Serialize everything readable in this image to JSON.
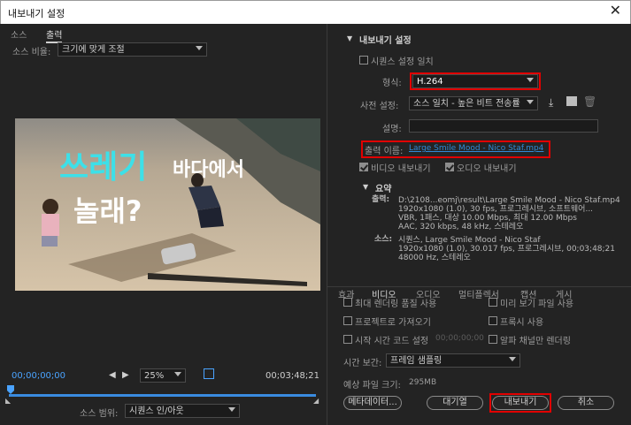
{
  "window": {
    "title": "내보내기 설정",
    "close_glyph": "✕"
  },
  "left": {
    "tabs": [
      {
        "label": "소스"
      },
      {
        "label": "출력"
      }
    ],
    "source_scaling_label": "소스 비율:",
    "source_scaling_value": "크기에 맞게 조절",
    "video_caption_line1": "쓰레기",
    "video_caption_line1b": "바다에서",
    "video_caption_line2": "놀래?",
    "timecode_current": "00;00;00;00",
    "timecode_duration": "00;03;48;21",
    "zoom_value": "25%",
    "source_range_label": "소스 범위:",
    "source_range_value": "시퀀스 인/아웃"
  },
  "right": {
    "section_title": "내보내기 설정",
    "match_sequence_label": "시퀀스 설정 일치",
    "format_label": "형식:",
    "format_value": "H.264",
    "preset_label": "사전 설정:",
    "preset_value": "소스 일치 - 높은 비트 전송률",
    "comments_label": "설명:",
    "output_name_label": "출력 이름:",
    "output_name_value": "Large Smile Mood - Nico Staf.mp4",
    "export_video_label": "비디오 내보내기",
    "export_audio_label": "오디오 내보내기",
    "summary_title": "요약",
    "summary_output_label": "출력:",
    "summary_output_lines": [
      "D:\\2108...eomj\\result\\Large Smile Mood - Nico Staf.mp4",
      "1920x1080 (1.0), 30 fps, 프로그레시브, 소프트웨어...",
      "VBR, 1패스, 대상 10.00 Mbps, 최대 12.00 Mbps",
      "AAC, 320 kbps, 48 kHz, 스테레오"
    ],
    "summary_source_label": "소스:",
    "summary_source_lines": [
      "시퀀스, Large Smile Mood - Nico Staf",
      "1920x1080 (1.0), 30.017 fps, 프로그레시브, 00;03;48;21",
      "48000 Hz, 스테레오"
    ],
    "tabs": [
      "효과",
      "비디오",
      "오디오",
      "멀티플렉서",
      "캡션",
      "게시"
    ],
    "opt_max_render": "최대 렌더링 품질 사용",
    "opt_preview": "미리 보기 파일 사용",
    "opt_import_project": "프로젝트로 가져오기",
    "opt_proxy": "프록시 사용",
    "opt_start_timecode": "시작 시간 코드 설정",
    "opt_start_timecode_value": "00;00;00;00",
    "opt_alpha": "알파 채널만 렌더링",
    "time_interp_label": "시간 보간:",
    "time_interp_value": "프레임 샘플링",
    "est_size_label": "예상 파일 크기:",
    "est_size_value": "295MB",
    "btn_metadata": "메타데이터...",
    "btn_queue": "대기열",
    "btn_export": "내보내기",
    "btn_cancel": "취소"
  },
  "colors": {
    "highlight_box": "#e10000",
    "accent_blue": "#2f8ad6",
    "caption_cyan": "#3de0e8"
  }
}
